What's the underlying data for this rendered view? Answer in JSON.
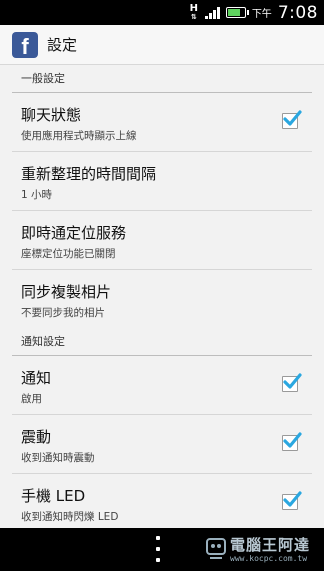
{
  "status_bar": {
    "network_indicator": "H",
    "battery_level": 0.8,
    "am_pm": "下午",
    "time": "7:08"
  },
  "action_bar": {
    "app_icon": "facebook-icon",
    "logo_letter": "f",
    "title": "設定"
  },
  "sections": [
    {
      "header": "一般設定",
      "items": [
        {
          "title": "聊天狀態",
          "subtitle": "使用應用程式時顯示上線",
          "checked": true
        },
        {
          "title": "重新整理的時間間隔",
          "subtitle": "1 小時"
        },
        {
          "title": "即時通定位服務",
          "subtitle": "座標定位功能已關閉"
        },
        {
          "title": "同步複製相片",
          "subtitle": "不要同步我的相片"
        }
      ]
    },
    {
      "header": "通知設定",
      "items": [
        {
          "title": "通知",
          "subtitle": "啟用",
          "checked": true
        },
        {
          "title": "震動",
          "subtitle": "收到通知時震動",
          "checked": true
        },
        {
          "title": "手機 LED",
          "subtitle": "收到通知時閃爍 LED",
          "checked": true
        }
      ]
    }
  ],
  "nav_bar": {
    "menu_icon": "overflow-menu-icon"
  },
  "watermark": {
    "text": "電腦王阿達",
    "url": "www.kocpc.com.tw"
  },
  "colors": {
    "facebook_blue": "#3b5998",
    "check_blue": "#2aa7e0"
  }
}
